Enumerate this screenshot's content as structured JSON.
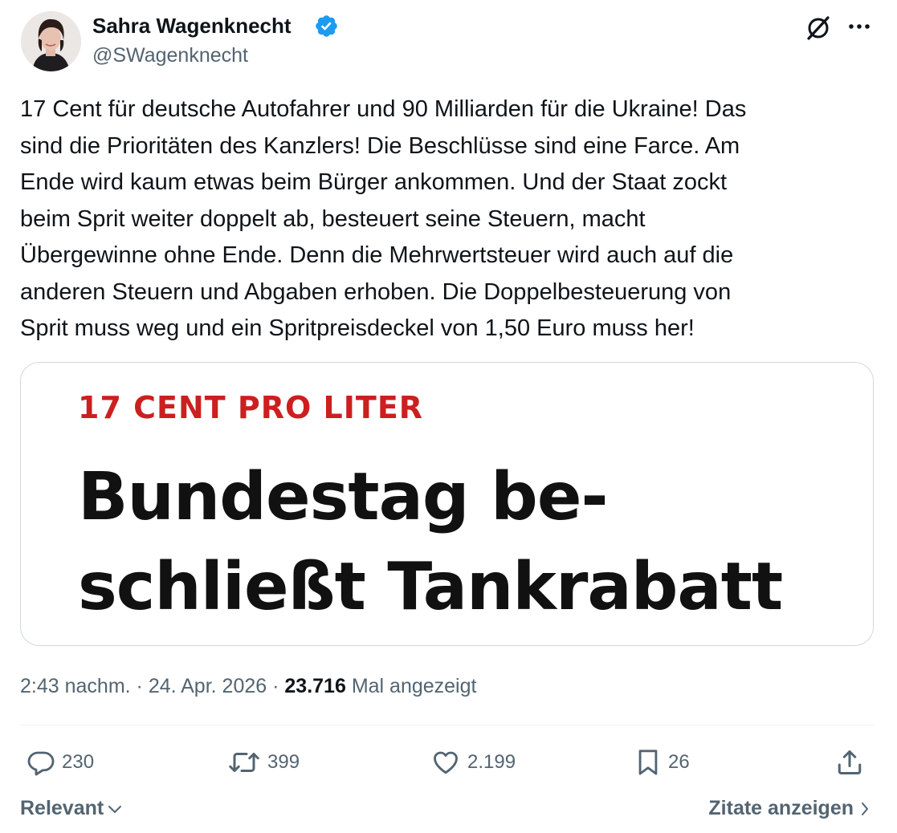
{
  "author": {
    "name": "Sahra Wagenknecht",
    "handle": "@SWagenknecht",
    "verified": true,
    "verified_color": "#1d9bf0"
  },
  "header_icons": [
    "grok-icon",
    "more-icon"
  ],
  "tweet": {
    "text": "17 Cent für deutsche Autofahrer und 90 Milliarden für die Ukraine! Das\nsind die Prioritäten des Kanzlers! Die Beschlüsse sind eine Farce. Am\nEnde wird kaum etwas beim Bürger ankommen. Und der Staat zockt\nbeim Sprit weiter doppelt ab, besteuert seine Steuern, macht\nÜbergewinne ohne Ende. Denn die Mehrwertsteuer wird auch auf die\nanderen Steuern und Abgaben erhoben. Die Doppelbesteuerung von\nSprit muss weg und ein Spritpreisdeckel von 1,50 Euro muss her!"
  },
  "media": {
    "kicker": "17 CENT PRO LITER",
    "kicker_color": "#cc1f1f",
    "headline": "Bundestag be-\nschließt Tankrabatt"
  },
  "meta": {
    "time": "2:43 nachm.",
    "separator": " · ",
    "date": "24. Apr. 2026",
    "views_count": "23.716",
    "views_label": "Mal angezeigt"
  },
  "actions": {
    "replies": "230",
    "reposts": "399",
    "likes": "2.199",
    "bookmarks": "26"
  },
  "footer": {
    "sort_label": "Relevant",
    "quotes_label": "Zitate anzeigen"
  },
  "colors": {
    "text_primary": "#0f1419",
    "text_secondary": "#536471",
    "border": "#cfd9de"
  }
}
